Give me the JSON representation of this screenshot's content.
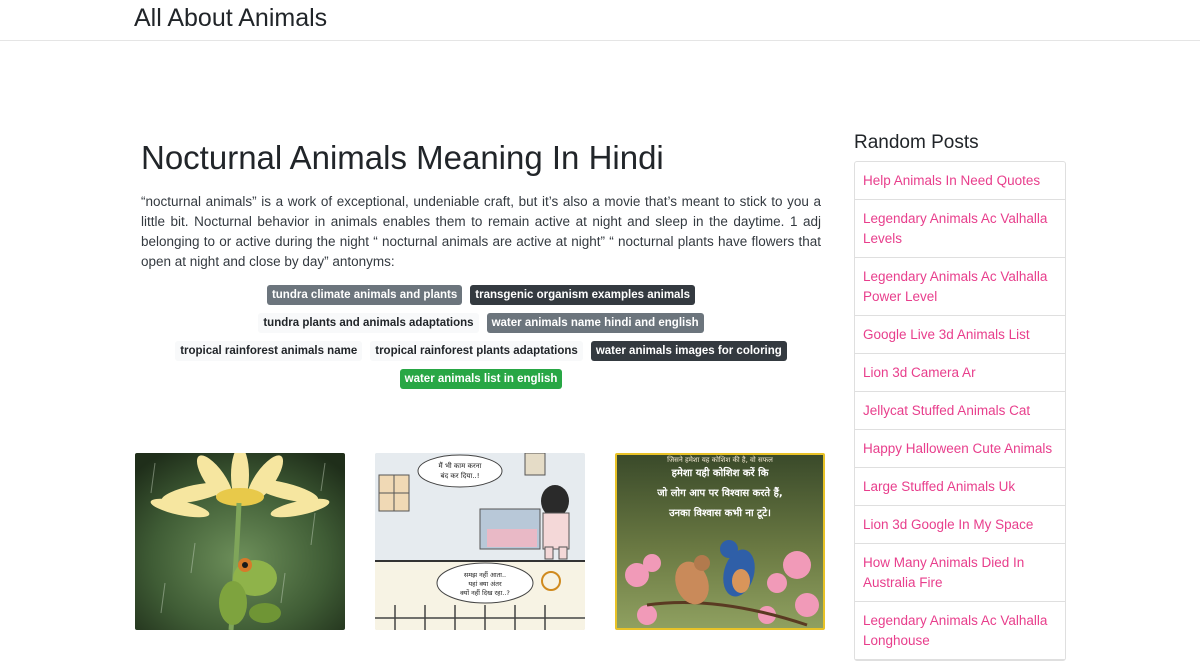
{
  "header": {
    "brand": "All About Animals"
  },
  "article": {
    "title": "Nocturnal Animals Meaning In Hindi",
    "description": "“nocturnal animals” is a work of exceptional, undeniable craft, but it’s also a movie that’s meant to stick to you a little bit. Nocturnal behavior in animals enables them to remain active at night and sleep in the daytime. 1 adj belonging to or active during the night “ nocturnal animals are active at night” “ nocturnal plants have flowers that open at night and close by day” antonyms:",
    "tags": [
      [
        {
          "label": "tundra climate animals and plants",
          "style": "secondary"
        },
        {
          "label": "transgenic organism examples animals",
          "style": "dark"
        }
      ],
      [
        {
          "label": "tundra plants and animals adaptations",
          "style": "light"
        },
        {
          "label": "water animals name hindi and english",
          "style": "secondary"
        }
      ],
      [
        {
          "label": "tropical rainforest animals name",
          "style": "light"
        },
        {
          "label": "tropical rainforest plants adaptations",
          "style": "light"
        },
        {
          "label": "water animals images for coloring",
          "style": "dark"
        }
      ],
      [
        {
          "label": "water animals list in english",
          "style": "success"
        }
      ]
    ]
  },
  "thumbnails": {
    "comic": {
      "bubble1_line1": "मैं भी काम करना",
      "bubble1_line2": "बंद कर दिया..!",
      "bubble2_line1": "समझ नहीं आता..",
      "bubble2_line2": "यहां क्या अंतर",
      "bubble2_line3": "क्यों नहीं दिख रहा..?"
    },
    "quote": {
      "line0": "जिसने हमेशा यह कोशिश की है, वो सफल",
      "line1": "हमेशा यही कोशिश करें कि",
      "line2": "जो लोग आप पर विश्वास करते हैं,",
      "line3": "उनका विश्वास कभी ना टूटे।"
    }
  },
  "sidebar": {
    "title": "Random Posts",
    "posts": [
      "Help Animals In Need Quotes",
      "Legendary Animals Ac Valhalla Levels",
      "Legendary Animals Ac Valhalla Power Level",
      "Google Live 3d Animals List",
      "Lion 3d Camera Ar",
      "Jellycat Stuffed Animals Cat",
      "Happy Halloween Cute Animals",
      "Large Stuffed Animals Uk",
      "Lion 3d Google In My Space",
      "How Many Animals Died In Australia Fire",
      "Legendary Animals Ac Valhalla Longhouse"
    ]
  }
}
